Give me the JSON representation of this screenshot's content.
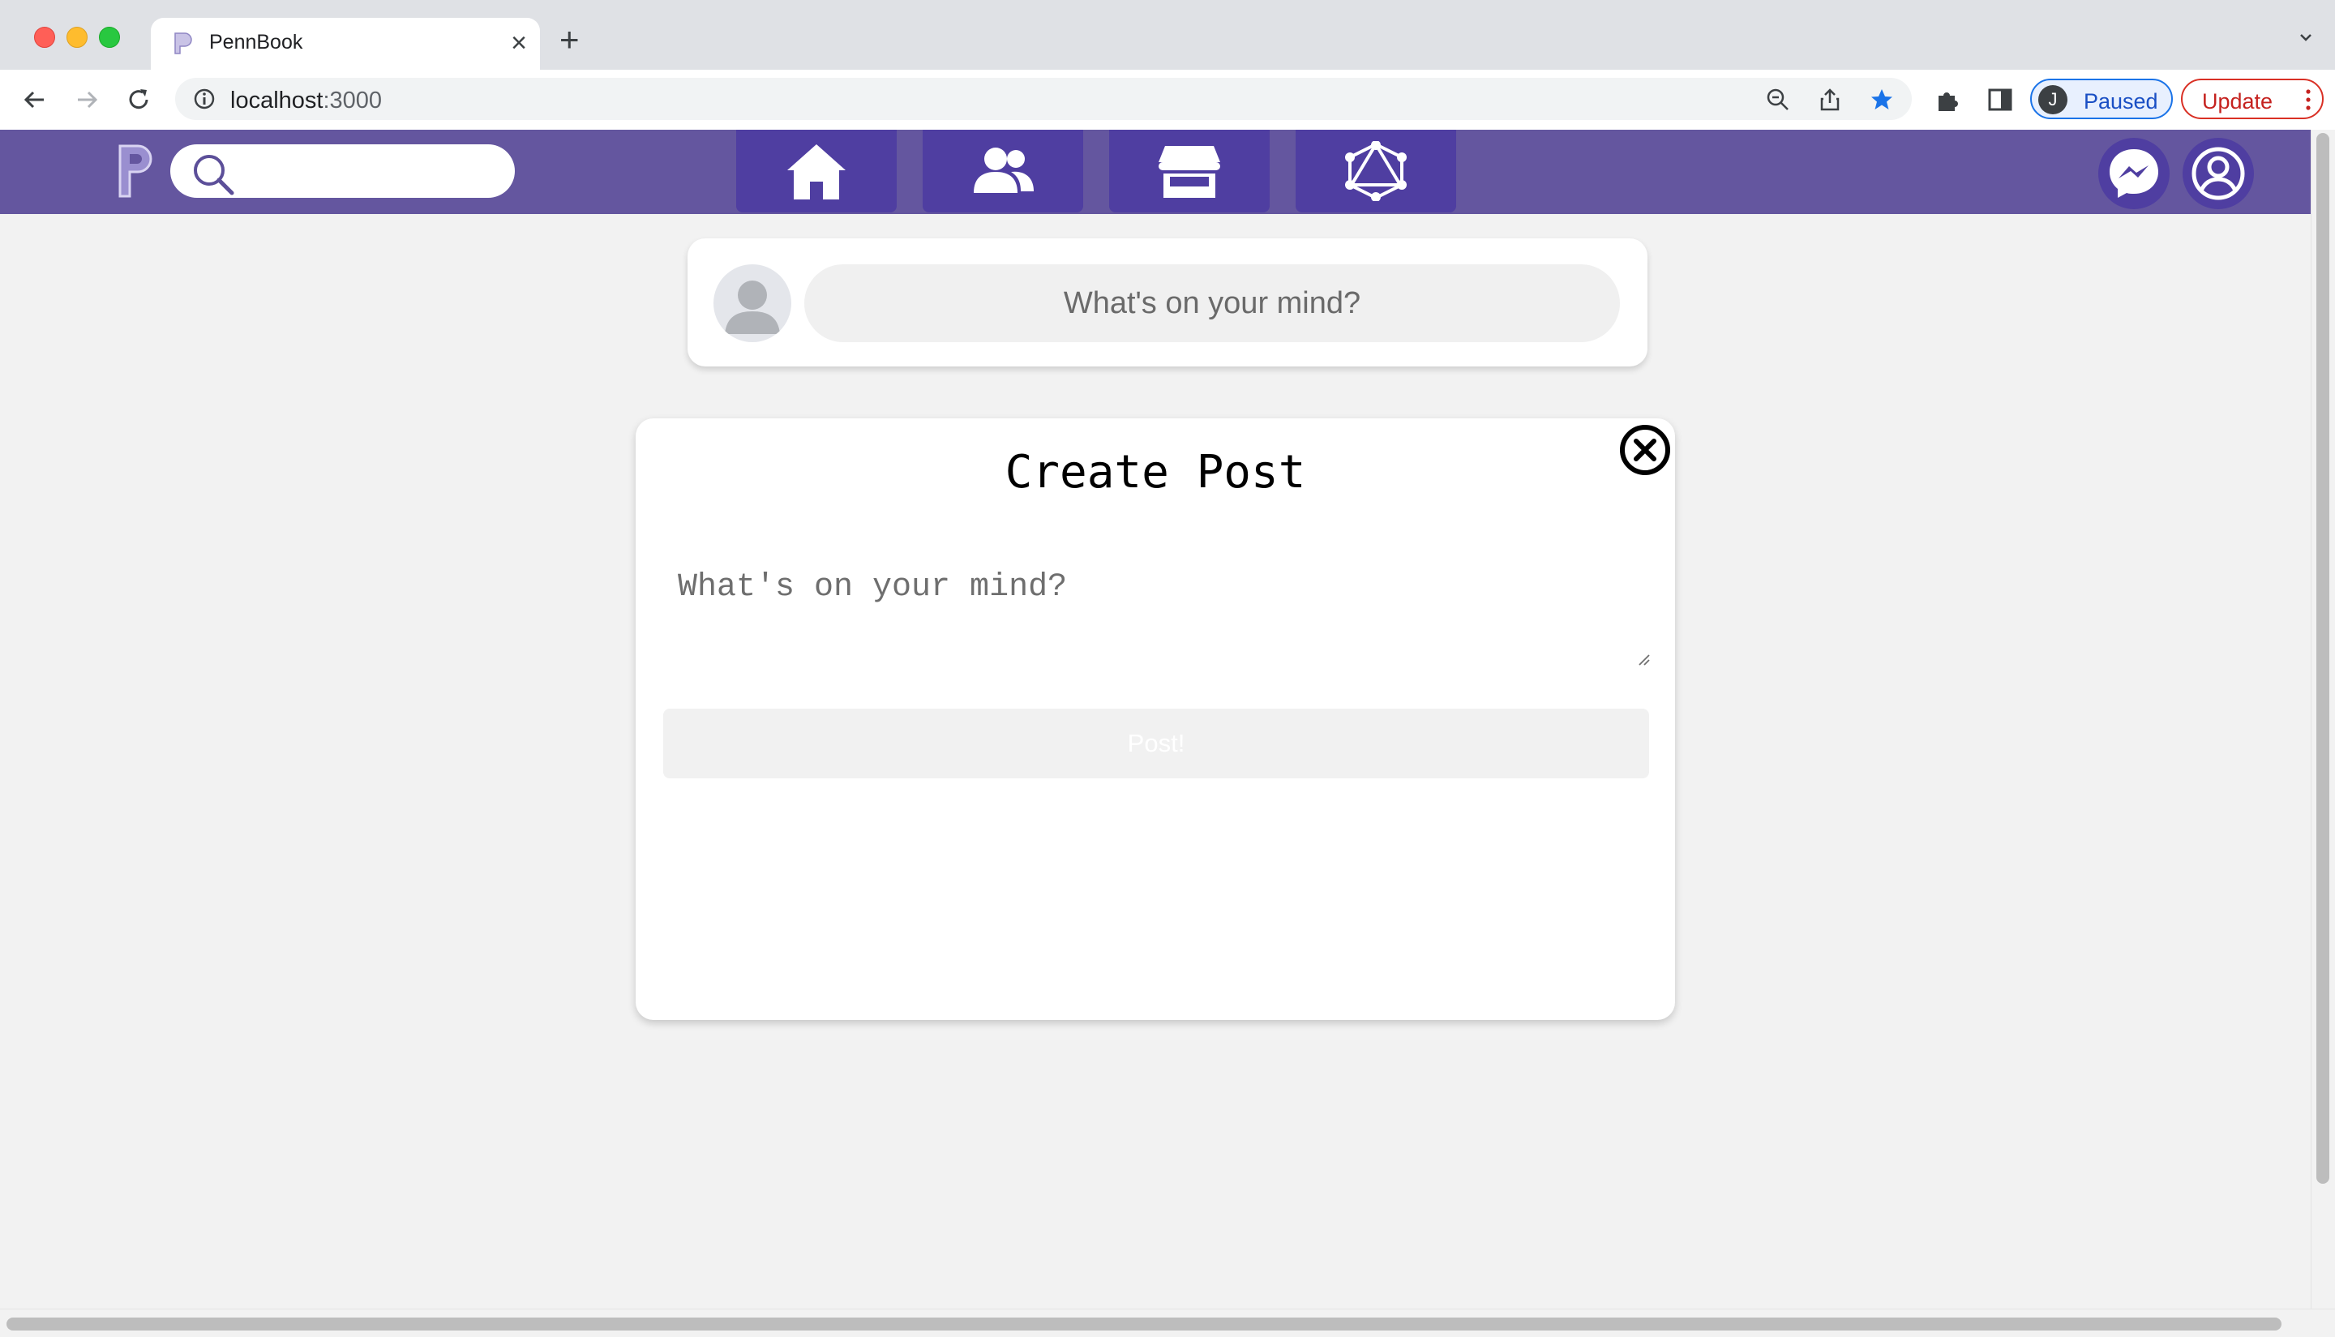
{
  "browser": {
    "tab_title": "PennBook",
    "url_host": "localhost",
    "url_path": ":3000",
    "profile_initial": "J",
    "profile_status": "Paused",
    "update_label": "Update"
  },
  "header": {
    "nav_icons": [
      "home-icon",
      "friends-icon",
      "marketplace-icon",
      "network-icon"
    ],
    "right_icons": [
      "messenger-icon",
      "account-icon"
    ],
    "accent_color": "#64569f",
    "tab_color": "#4f3ea1"
  },
  "composer": {
    "placeholder": "What's on your mind?"
  },
  "modal": {
    "title": "Create Post",
    "textarea_placeholder": "What's on your mind?",
    "submit_label": "Post!"
  }
}
